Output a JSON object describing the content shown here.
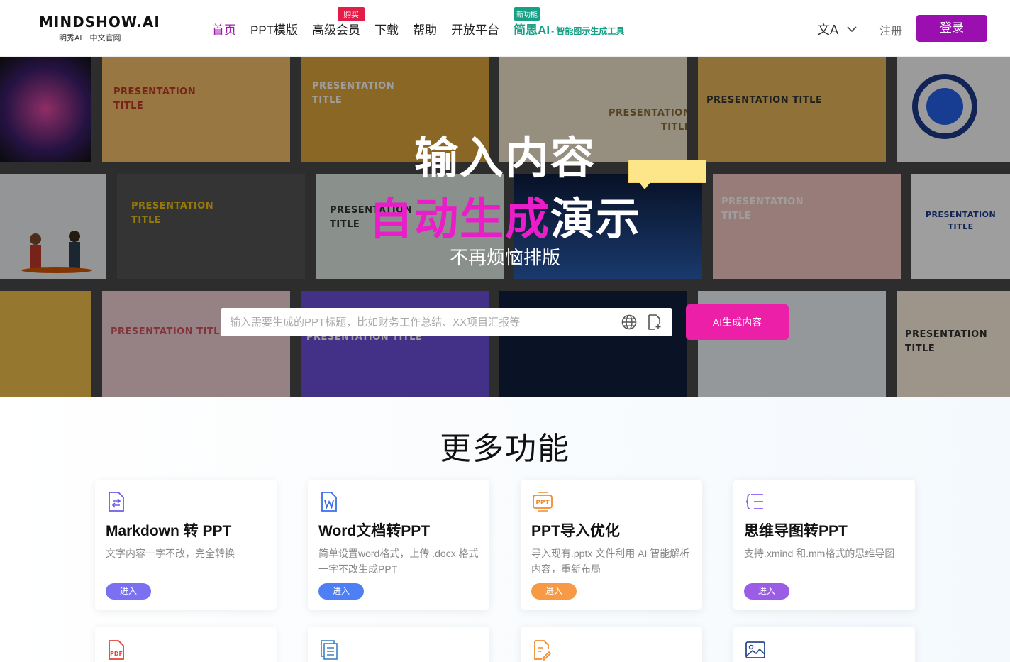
{
  "header": {
    "logo_main": "MINDSHOW.AI",
    "logo_sub_1": "明秀AI",
    "logo_sub_2": "中文官网",
    "nav": [
      {
        "label": "首页",
        "active": true
      },
      {
        "label": "PPT模版"
      },
      {
        "label": "高级会员",
        "badge": "购买"
      },
      {
        "label": "下载"
      },
      {
        "label": "帮助"
      },
      {
        "label": "开放平台"
      }
    ],
    "jiansi": {
      "badge": "新功能",
      "label": "简思AI",
      "suffix": "- 智能图示生成工具"
    },
    "lang_icon": "文A",
    "register": "注册",
    "login": "登录"
  },
  "hero": {
    "title_line1": "输入内容",
    "title_line2_pink": "自动生成",
    "title_line2_white": "演示",
    "subtitle": "不再烦恼排版",
    "search_placeholder": "输入需要生成的PPT标题，比如财务工作总结、XX项目汇报等",
    "ai_button": "AI生成内容",
    "tiles": [
      {
        "text": "PRESENTATION\nTITLE",
        "bg": "#f5c16c",
        "fg": "#c0392b"
      },
      {
        "text": "PRESENTATION\nTITLE",
        "bg": "#e0a63c",
        "fg": "#ffffff"
      },
      {
        "text": "PRESENTATION\nTITLE",
        "bg": "#f2e7cf",
        "fg": "#8a6d3b"
      },
      {
        "text": "PRESENTATION TITLE",
        "bg": "#e9b95b",
        "fg": "#333333"
      },
      {
        "text": "PRESENTATION\nTITLE",
        "bg": "#555555",
        "fg": "#f1c40f"
      },
      {
        "text": "PRESENTATION\nTITLE",
        "bg": "#dfe9e2",
        "fg": "#333333"
      },
      {
        "text": "PRESENTATION\nTITLE",
        "bg": "#f4c9c4",
        "fg": "#ffffff"
      },
      {
        "text": "PRESENTATION\nTITLE",
        "bg": "#ffffff",
        "fg": "#1e3a8a"
      },
      {
        "text": "PRESENTATION TITLE",
        "bg": "#f3d0d6",
        "fg": "#d4555f"
      },
      {
        "text": "PRESENTATION TITLE",
        "bg": "#6b4fd8",
        "fg": "#ffffff"
      },
      {
        "text": "PRESENTATION TITLE",
        "bg": "#fdf1dd",
        "fg": "#333333"
      }
    ]
  },
  "features": {
    "title": "更多功能",
    "cards": [
      {
        "icon": "markdown-file-icon",
        "title": "Markdown 转 PPT",
        "desc": "文字内容一字不改，完全转换",
        "button": "进入",
        "color": "#7b6ff2"
      },
      {
        "icon": "word-file-icon",
        "title": "Word文档转PPT",
        "desc": "简单设置word格式，上传 .docx 格式一字不改生成PPT",
        "button": "进入",
        "color": "#4f7ff5"
      },
      {
        "icon": "ppt-file-icon",
        "title": "PPT导入优化",
        "desc": "导入现有.pptx 文件利用 AI 智能解析内容，重新布局",
        "button": "进入",
        "color": "#f79a45"
      },
      {
        "icon": "mindmap-icon",
        "title": "思维导图转PPT",
        "desc": "支持.xmind 和.mm格式的思维导图",
        "button": "进入",
        "color": "#9b5de5"
      }
    ],
    "second_row_icons": [
      "pdf-file-icon",
      "document-list-icon",
      "edit-file-icon",
      "image-icon"
    ],
    "ppt_icon_text": "PPT",
    "pdf_icon_text": "PDF"
  }
}
